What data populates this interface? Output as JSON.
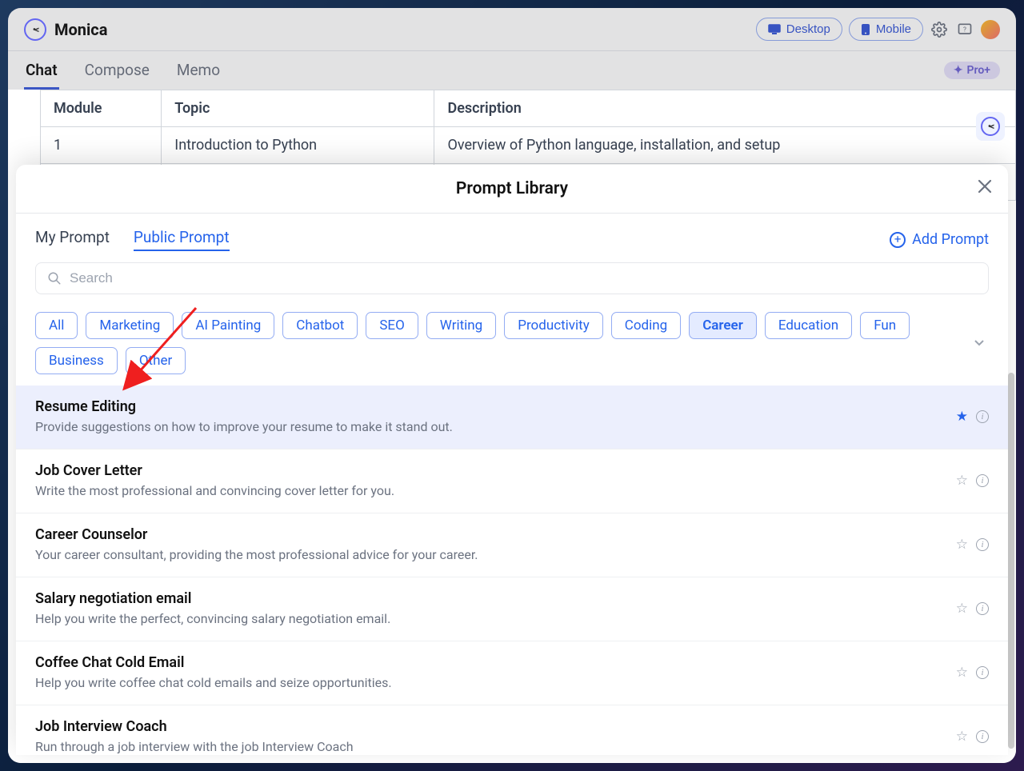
{
  "brand": {
    "name": "Monica"
  },
  "top": {
    "desktop": "Desktop",
    "mobile": "Mobile"
  },
  "tabs": {
    "chat": "Chat",
    "compose": "Compose",
    "memo": "Memo",
    "pro": "Pro+"
  },
  "bg_table": {
    "headers": [
      "Module",
      "Topic",
      "Description"
    ],
    "rows": [
      [
        "1",
        "Introduction to Python",
        "Overview of Python language, installation, and setup"
      ]
    ]
  },
  "modal": {
    "title": "Prompt Library",
    "tabs": {
      "my": "My Prompt",
      "public": "Public Prompt"
    },
    "add": "Add Prompt",
    "search_placeholder": "Search",
    "filters": [
      "All",
      "Marketing",
      "AI Painting",
      "Chatbot",
      "SEO",
      "Writing",
      "Productivity",
      "Coding",
      "Career",
      "Education",
      "Fun",
      "Business",
      "Other"
    ],
    "active_filter": "Career",
    "prompts": [
      {
        "title": "Resume Editing",
        "desc": "Provide suggestions on how to improve your resume to make it stand out.",
        "starred": true,
        "highlight": true
      },
      {
        "title": "Job Cover Letter",
        "desc": "Write the most professional and convincing cover letter for you.",
        "starred": false,
        "highlight": false
      },
      {
        "title": "Career Counselor",
        "desc": "Your career consultant, providing the most professional advice for your career.",
        "starred": false,
        "highlight": false
      },
      {
        "title": "Salary negotiation email",
        "desc": "Help you write the perfect, convincing salary negotiation email.",
        "starred": false,
        "highlight": false
      },
      {
        "title": "Coffee Chat Cold Email",
        "desc": "Help you write coffee chat cold emails and seize opportunities.",
        "starred": false,
        "highlight": false
      },
      {
        "title": "Job Interview Coach",
        "desc": "Run through a job interview with the job Interview Coach",
        "starred": false,
        "highlight": false
      }
    ]
  }
}
